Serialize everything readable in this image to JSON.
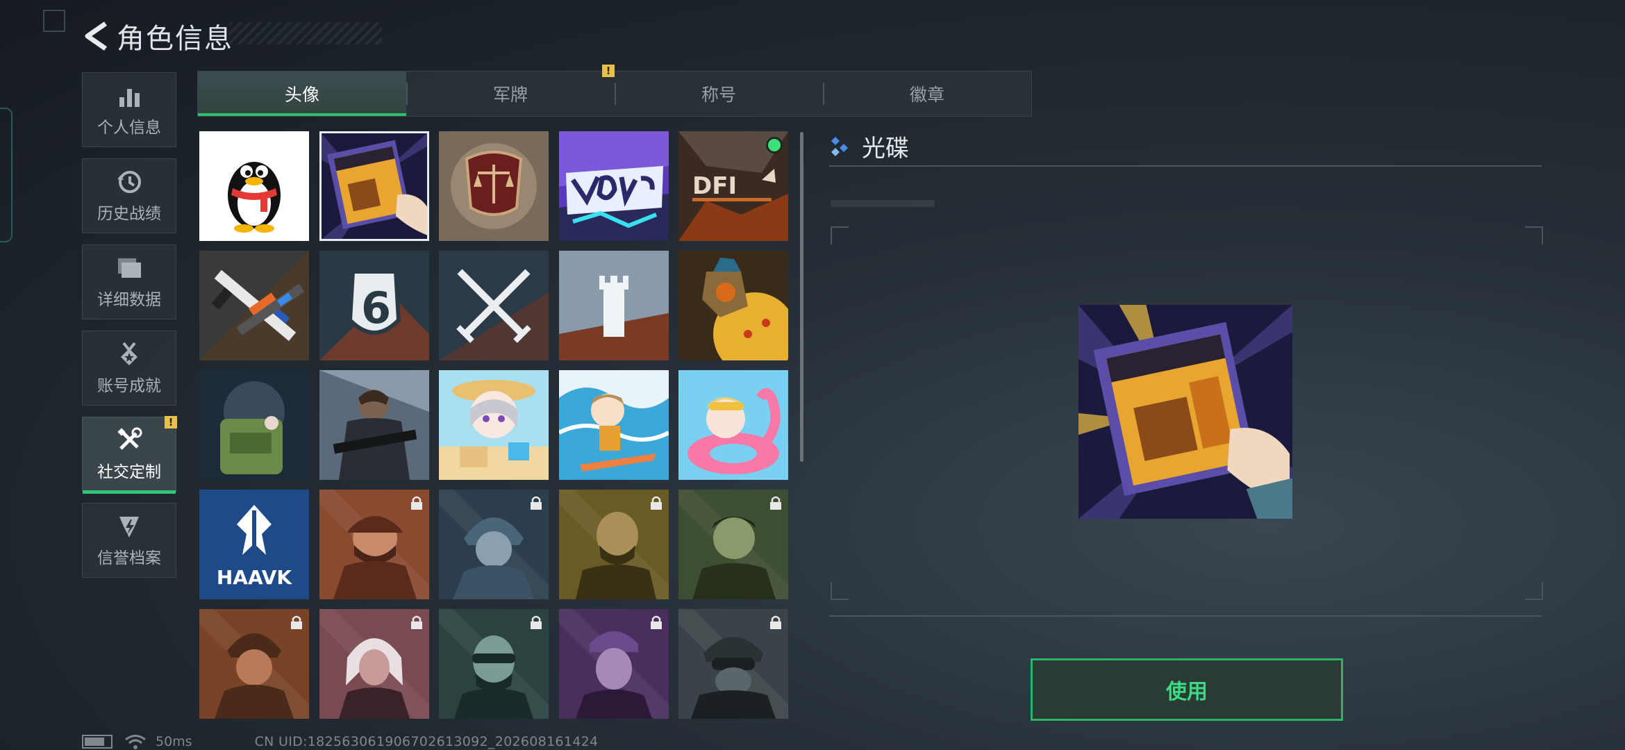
{
  "header": {
    "title": "角色信息",
    "back_icon": "back-arrow-icon"
  },
  "sidebar": {
    "items": [
      {
        "label": "个人信息",
        "icon": "bar-chart-icon",
        "active": false
      },
      {
        "label": "历史战绩",
        "icon": "history-icon",
        "active": false
      },
      {
        "label": "详细数据",
        "icon": "folder-icon",
        "active": false
      },
      {
        "label": "账号成就",
        "icon": "medal-icon",
        "active": false
      },
      {
        "label": "社交定制",
        "icon": "tools-icon",
        "active": true,
        "alert": "!"
      },
      {
        "label": "信誉档案",
        "icon": "reputation-icon",
        "active": false
      }
    ]
  },
  "tabs": {
    "items": [
      {
        "label": "头像",
        "active": true
      },
      {
        "label": "军牌",
        "active": false,
        "alert": "!"
      },
      {
        "label": "称号",
        "active": false
      },
      {
        "label": "徽章",
        "active": false
      }
    ]
  },
  "avatars": [
    {
      "name": "qq-penguin",
      "locked": false
    },
    {
      "name": "black-hawk-down-disc",
      "locked": false,
      "selected": true
    },
    {
      "name": "justice-scales-emblem",
      "locked": false
    },
    {
      "name": "voyager-graffiti",
      "locked": false
    },
    {
      "name": "dfi-logo",
      "locked": false,
      "new_dot": true
    },
    {
      "name": "weapons-crossed",
      "locked": false
    },
    {
      "name": "shield-six",
      "locked": false
    },
    {
      "name": "crossed-swords",
      "locked": false
    },
    {
      "name": "tower",
      "locked": false
    },
    {
      "name": "mech-pizza",
      "locked": false
    },
    {
      "name": "chibi-soldier-backpack",
      "locked": false
    },
    {
      "name": "soldier-rifle",
      "locked": false
    },
    {
      "name": "chibi-sandcastle",
      "locked": false
    },
    {
      "name": "chibi-surfer",
      "locked": false
    },
    {
      "name": "chibi-flamingo",
      "locked": false
    },
    {
      "name": "haavk-logo",
      "locked": false,
      "logo_text": "HAAVK"
    },
    {
      "name": "operator-cap-red",
      "locked": true
    },
    {
      "name": "operator-helmet-blue",
      "locked": true
    },
    {
      "name": "operator-bald-yellow",
      "locked": true
    },
    {
      "name": "operator-green",
      "locked": true
    },
    {
      "name": "operator-helmet-orange",
      "locked": true
    },
    {
      "name": "operator-white-hair",
      "locked": true
    },
    {
      "name": "operator-goggles-teal",
      "locked": true
    },
    {
      "name": "operator-purple",
      "locked": true
    },
    {
      "name": "operator-mask-gray",
      "locked": true
    }
  ],
  "detail": {
    "title": "光碟",
    "use_label": "使用"
  },
  "status": {
    "ping": "50ms",
    "uid": "CN UID:18256306190670261309​2_202608161424"
  },
  "colors": {
    "accent": "#2fbf72",
    "warning": "#e8c04a",
    "selected_outline": "#e7ecef"
  }
}
